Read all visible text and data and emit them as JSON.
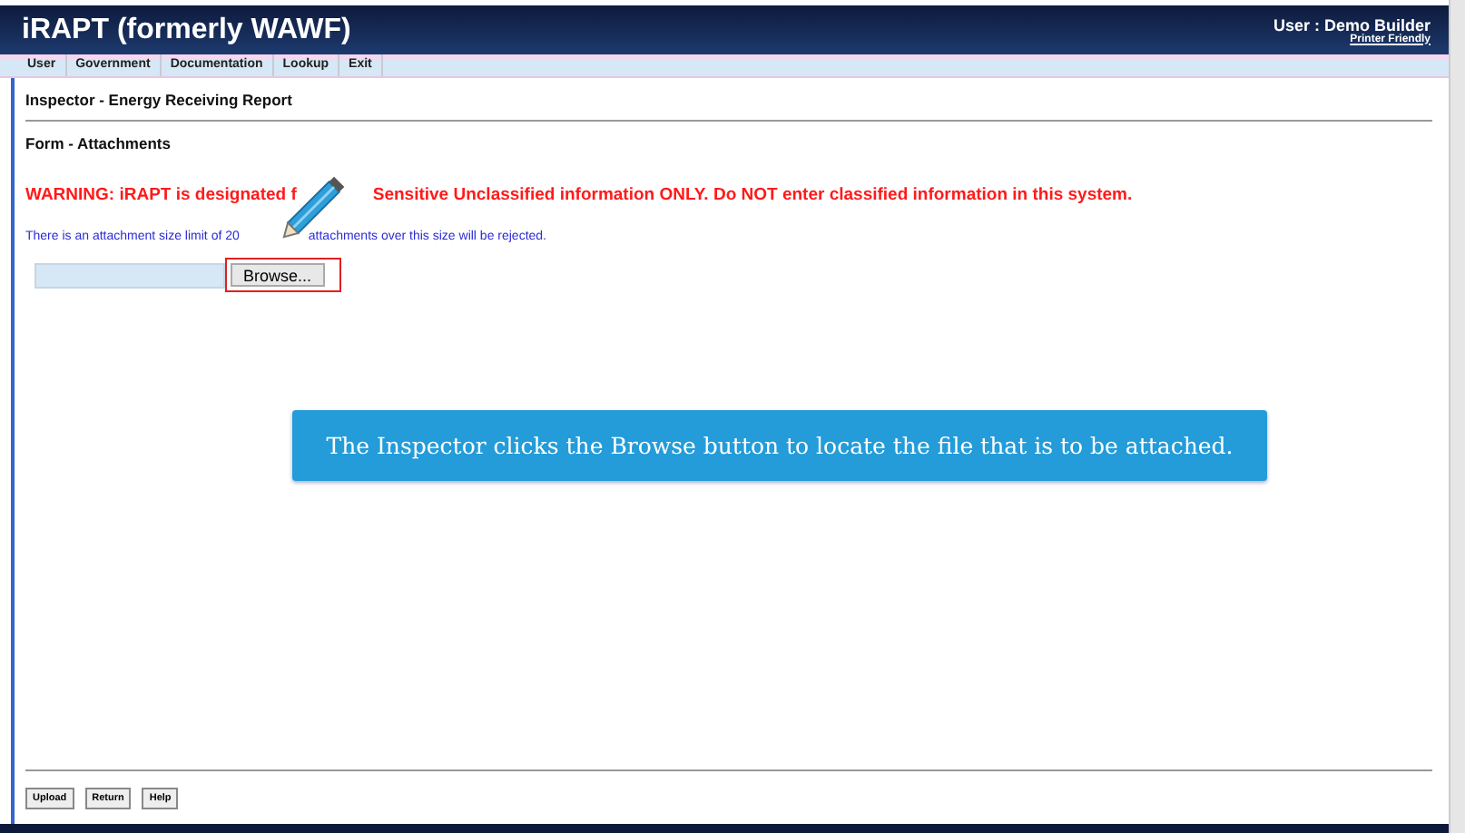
{
  "header": {
    "title": "iRAPT (formerly WAWF)",
    "user": "User : Demo Builder",
    "printer_link": "Printer Friendly"
  },
  "menu": [
    "User",
    "Government",
    "Documentation",
    "Lookup",
    "Exit"
  ],
  "page_title": "Inspector - Energy Receiving Report",
  "section_title": "Form - Attachments",
  "warning": [
    "WARNING: iRAPT is designated f",
    "Sensitive Unclassified information ONLY. Do NOT enter classified information in this system."
  ],
  "size_note": [
    "There is an attachment size limit of 20",
    "attachments over this size will be rejected."
  ],
  "file_input": {
    "button": "Browse...",
    "highlighted": true
  },
  "callout": "The Inspector clicks the Browse button to locate the file that is to be attached.",
  "buttons": [
    "Upload",
    "Return",
    "Help"
  ]
}
